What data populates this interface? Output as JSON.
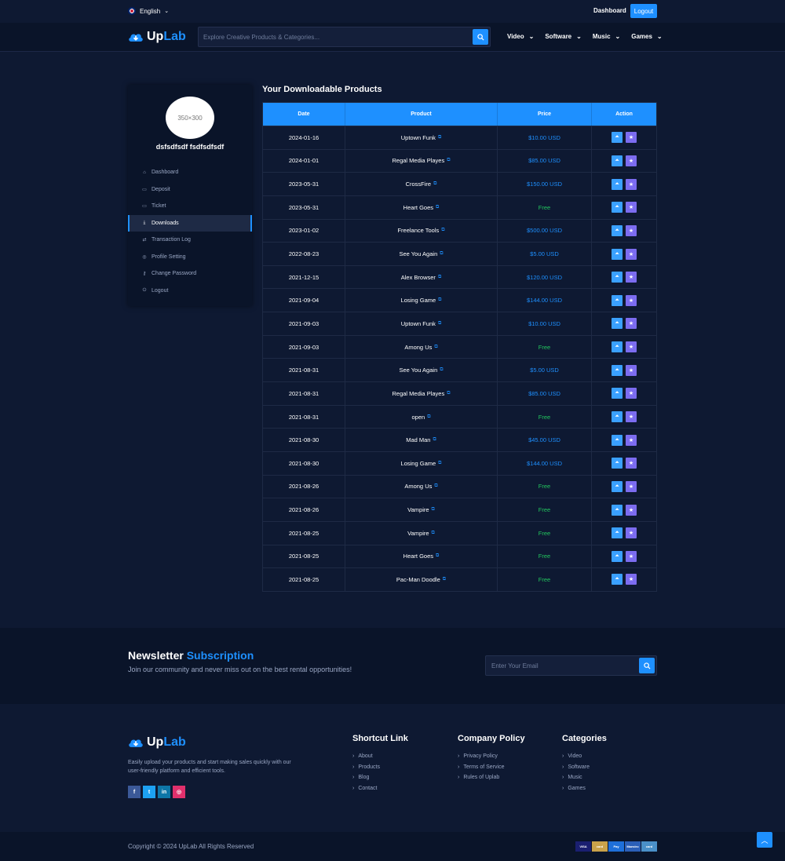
{
  "topbar": {
    "language": "English",
    "dashboard": "Dashboard",
    "logout": "Logout"
  },
  "nav": {
    "logo_up": "Up",
    "logo_lab": "Lab",
    "search_placeholder": "Explore Creative Products & Categories...",
    "items": [
      "Video",
      "Software",
      "Music",
      "Games"
    ]
  },
  "sidebar": {
    "avatar_text": "350×300",
    "username": "dsfsdfsdf fsdfsdfsdf",
    "menu": [
      "Dashboard",
      "Deposit",
      "Ticket",
      "Downloads",
      "Transaction Log",
      "Profile Setting",
      "Change Password",
      "Logout"
    ],
    "active_index": 3
  },
  "main": {
    "title": "Your Downloadable Products",
    "headers": [
      "Date",
      "Product",
      "Price",
      "Action"
    ],
    "rows": [
      {
        "date": "2024-01-16",
        "product": "Uptown Funk",
        "price": "$10.00 USD"
      },
      {
        "date": "2024-01-01",
        "product": "Regal Media Playes",
        "price": "$85.00 USD"
      },
      {
        "date": "2023-05-31",
        "product": "CrossFire",
        "price": "$150.00 USD"
      },
      {
        "date": "2023-05-31",
        "product": "Heart Goes",
        "price": "Free"
      },
      {
        "date": "2023-01-02",
        "product": "Freelance Tools",
        "price": "$500.00 USD"
      },
      {
        "date": "2022-08-23",
        "product": "See You Again",
        "price": "$5.00 USD"
      },
      {
        "date": "2021-12-15",
        "product": "Alex Browser",
        "price": "$120.00 USD"
      },
      {
        "date": "2021-09-04",
        "product": "Losing Game",
        "price": "$144.00 USD"
      },
      {
        "date": "2021-09-03",
        "product": "Uptown Funk",
        "price": "$10.00 USD"
      },
      {
        "date": "2021-09-03",
        "product": "Among Us",
        "price": "Free"
      },
      {
        "date": "2021-08-31",
        "product": "See You Again",
        "price": "$5.00 USD"
      },
      {
        "date": "2021-08-31",
        "product": "Regal Media Playes",
        "price": "$85.00 USD"
      },
      {
        "date": "2021-08-31",
        "product": "open",
        "price": "Free"
      },
      {
        "date": "2021-08-30",
        "product": "Mad Man",
        "price": "$45.00 USD"
      },
      {
        "date": "2021-08-30",
        "product": "Losing Game",
        "price": "$144.00 USD"
      },
      {
        "date": "2021-08-26",
        "product": "Among Us",
        "price": "Free"
      },
      {
        "date": "2021-08-26",
        "product": "Vampire",
        "price": "Free"
      },
      {
        "date": "2021-08-25",
        "product": "Vampire",
        "price": "Free"
      },
      {
        "date": "2021-08-25",
        "product": "Heart Goes",
        "price": "Free"
      },
      {
        "date": "2021-08-25",
        "product": "Pac-Man Doodle",
        "price": "Free"
      }
    ]
  },
  "newsletter": {
    "title_a": "Newsletter",
    "title_b": "Subscription",
    "desc": "Join our community and never miss out on the best rental opportunities!",
    "placeholder": "Enter Your Email"
  },
  "footer": {
    "desc": "Easily upload your products and start making sales quickly with our user-friendly platform and efficient tools.",
    "columns": [
      {
        "title": "Shortcut Link",
        "links": [
          "About",
          "Products",
          "Blog",
          "Contact"
        ]
      },
      {
        "title": "Company Policy",
        "links": [
          "Privacy Policy",
          "Terms of Service",
          "Rules of Uplab"
        ]
      },
      {
        "title": "Categories",
        "links": [
          "Video",
          "Software",
          "Music",
          "Games"
        ]
      }
    ],
    "copyright": "Copyright © 2024 UpLab All Rights Reserved",
    "payments": [
      "VISA",
      "card",
      "Pay",
      "Maestro",
      "card"
    ]
  },
  "colors": {
    "accent": "#1e90ff",
    "free": "#22c55e",
    "star": "#7c6cf0",
    "bg": "#0e1932"
  }
}
